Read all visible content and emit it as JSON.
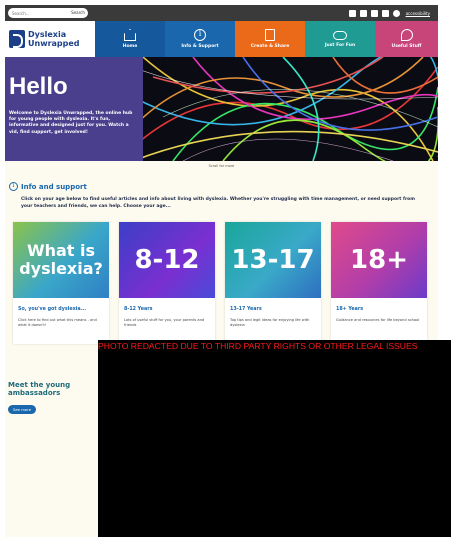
{
  "search": {
    "placeholder": "Search...",
    "button_label": "Search"
  },
  "social": {
    "icons": [
      "facebook-icon",
      "twitter-icon",
      "youtube-icon",
      "instagram-icon",
      "tiktok-icon"
    ],
    "accessibility_label": "accessibility"
  },
  "brand": {
    "line1": "Dyslexia",
    "line2": "Unwrapped"
  },
  "nav": {
    "home": "Home",
    "info": "Info & Support",
    "create": "Create & Share",
    "fun": "Just For Fun",
    "useful": "Useful Stuff"
  },
  "hero": {
    "title": "Hello",
    "text": "Welcome to Dyslexia Unwrapped, the online hub for young people with dyslexia. It's fun, informative and designed just for you. Watch a vid, find support, get involved!"
  },
  "scroll_hint": "Scroll for more",
  "info": {
    "title": "Info and support",
    "description": "Click on your age below to find useful articles and info about living with dyslexia. Whether you're struggling with time management, or need support from your teachers and friends, we can help. Choose your age..."
  },
  "cards": [
    {
      "image_text": "What is dyslexia?",
      "title": "So, you've got dyslexia...",
      "text": "Click here to find out what this means - and what it doesn't!"
    },
    {
      "image_text": "8-12",
      "title": "8-12 Years",
      "text": "Lots of useful stuff for you, your parents and friends"
    },
    {
      "image_text": "13-17",
      "title": "13-17 Years",
      "text": "Top tips and legit ideas for enjoying life with dyslexia"
    },
    {
      "image_text": "18+",
      "title": "18+ Years",
      "text": "Guidance and resources for life beyond school"
    }
  ],
  "ambassadors": {
    "title": "Meet the young ambassadors",
    "button_label": "See more"
  },
  "redaction": {
    "text": "PHOTO REDACTED DUE TO THIRD PARTY RIGHTS OR OTHER LEGAL ISSUES"
  },
  "colors": {
    "home": "#16589c",
    "info": "#1b67ad",
    "create": "#ea6a1a",
    "fun": "#1f9b94",
    "useful": "#c8457a",
    "hero_panel": "#4a3f8c"
  }
}
